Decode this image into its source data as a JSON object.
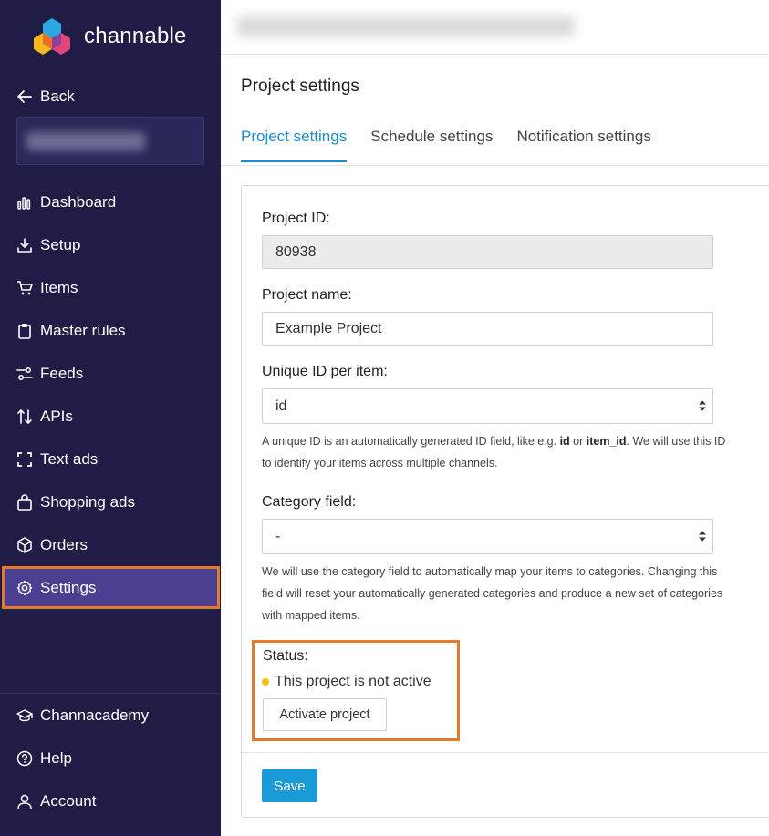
{
  "brand": {
    "name": "channable"
  },
  "sidebar": {
    "back_label": "Back",
    "items": [
      {
        "label": "Dashboard",
        "icon": "bar-chart-icon"
      },
      {
        "label": "Setup",
        "icon": "download-tray-icon"
      },
      {
        "label": "Items",
        "icon": "cart-icon"
      },
      {
        "label": "Master rules",
        "icon": "clipboard-icon"
      },
      {
        "label": "Feeds",
        "icon": "feeds-icon"
      },
      {
        "label": "APIs",
        "icon": "arrows-up-down-icon"
      },
      {
        "label": "Text ads",
        "icon": "corners-icon"
      },
      {
        "label": "Shopping ads",
        "icon": "shopping-bag-icon"
      },
      {
        "label": "Orders",
        "icon": "box-icon"
      },
      {
        "label": "Settings",
        "icon": "gear-icon",
        "active": true
      }
    ],
    "bottom_items": [
      {
        "label": "Channacademy",
        "icon": "graduation-cap-icon"
      },
      {
        "label": "Help",
        "icon": "question-circle-icon"
      },
      {
        "label": "Account",
        "icon": "user-icon"
      }
    ]
  },
  "page": {
    "title": "Project settings",
    "tabs": [
      {
        "label": "Project settings",
        "active": true
      },
      {
        "label": "Schedule settings"
      },
      {
        "label": "Notification settings"
      }
    ]
  },
  "form": {
    "project_id": {
      "label": "Project ID:",
      "value": "80938"
    },
    "project_name": {
      "label": "Project name:",
      "value": "Example Project"
    },
    "unique_id": {
      "label": "Unique ID per item:",
      "value": "id",
      "help_prefix": "A unique ID is an automatically generated ID field, like e.g. ",
      "help_code1": "id",
      "help_or": " or ",
      "help_code2": "item_id",
      "help_suffix": ". We will use this ID to identify your items across multiple channels."
    },
    "category": {
      "label": "Category field:",
      "value": "-",
      "help": "We will use the category field to automatically map your items to categories. Changing this field will reset your automatically generated categories and produce a new set of categories with mapped items."
    },
    "status": {
      "label": "Status:",
      "text": "This project is not active",
      "dot_color": "#f2c200",
      "activate_label": "Activate project"
    },
    "save_label": "Save"
  },
  "colors": {
    "sidebar_bg": "#1f1d45",
    "active_item_bg": "#4c3f8f",
    "highlight": "#e47a2b",
    "accent": "#1a9ad6"
  }
}
